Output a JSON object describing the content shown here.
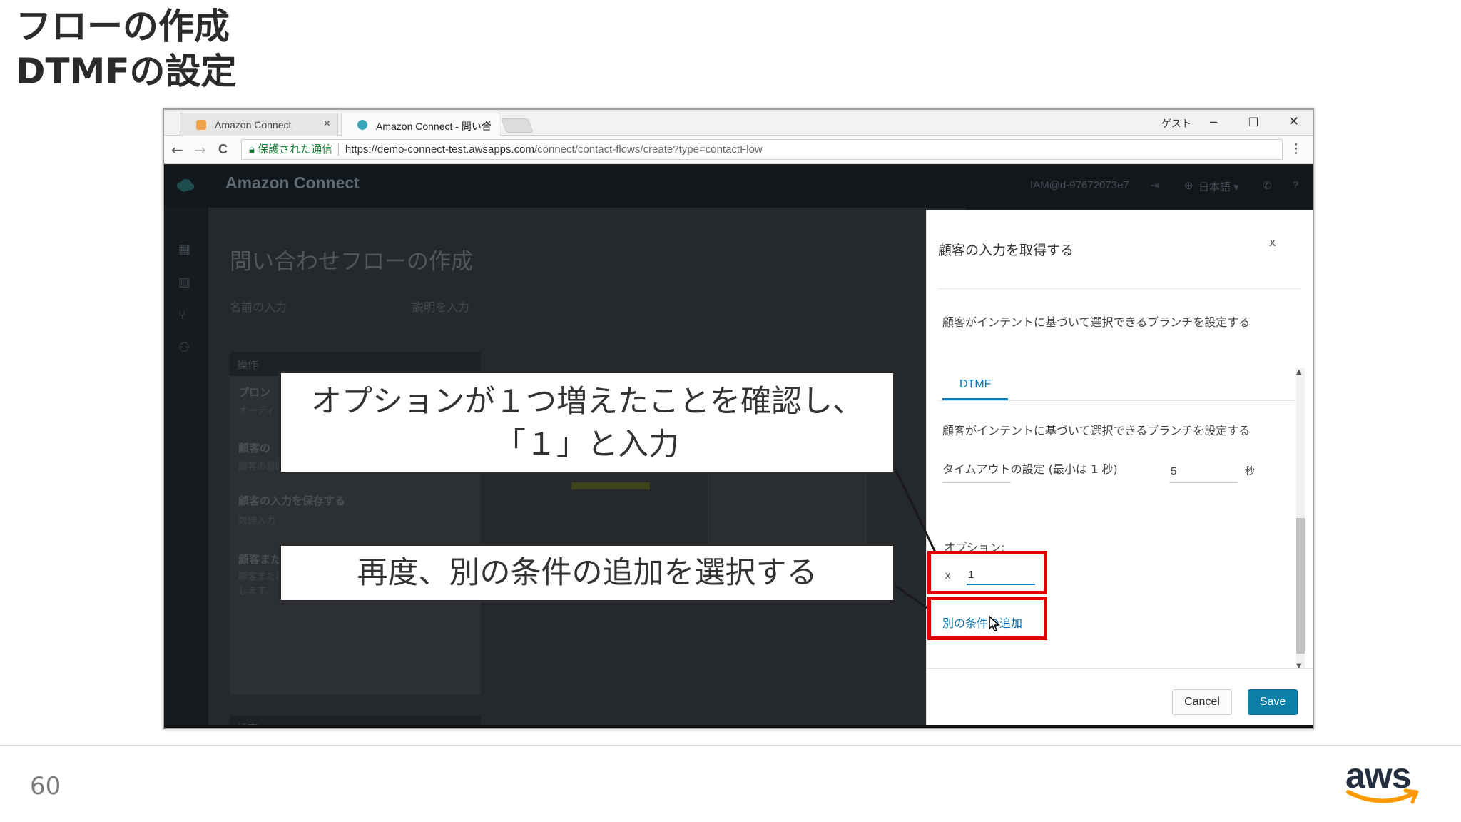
{
  "slide": {
    "title_line1": "フローの作成",
    "title_line2": "DTMFの設定",
    "page_number": "60",
    "logo_text": "aws"
  },
  "browser": {
    "tabs": [
      {
        "label": "Amazon Connect",
        "close": "×"
      },
      {
        "label": "Amazon Connect - 問い合",
        "close": "×"
      }
    ],
    "window_controls": {
      "guest": "ゲスト",
      "minimize": "–",
      "restore": "❐",
      "close": "✕"
    },
    "nav": {
      "back": "←",
      "forward": "→",
      "reload": "C"
    },
    "address": {
      "secure_label": "保護された通信",
      "url_host": "https://demo-connect-test.awsapps.com",
      "url_path": "/connect/contact-flows/create?type=contactFlow"
    },
    "menu": "⋮"
  },
  "app": {
    "title": "Amazon Connect",
    "user": "IAM@d-97672073e7",
    "language": "日本語 ▾",
    "help": "?",
    "page_heading": "問い合わせフローの作成",
    "name_placeholder": "名前の入力",
    "desc_placeholder": "説明を入力",
    "operations": {
      "header": "操作",
      "items": [
        {
          "title": "プロン",
          "desc": "オーディ"
        },
        {
          "title": "顧客の",
          "desc": "顧客の意図に基づいて分岐します。"
        },
        {
          "title": "顧客の入力を保存する",
          "desc": "数値入力"
        },
        {
          "title": "顧客またはエージェントの保留",
          "desc": "顧客またはエージェントとの通話を保留または保留解除します。"
        }
      ],
      "settings_header": "設定"
    }
  },
  "modal": {
    "title": "顧客の入力を取得する",
    "close": "x",
    "description": "顧客がインテントに基づいて選択できるブランチを設定する",
    "tab": "DTMF",
    "tab_description": "顧客がインテントに基づいて選択できるブランチを設定する",
    "timeout_label": "タイムアウトの設定 (最小は 1 秒)",
    "timeout_value": "5",
    "timeout_unit": "秒",
    "option_label": "オプション:",
    "option_remove": "x",
    "option_value": "1",
    "add_condition": "別の条件の追加",
    "cancel": "Cancel",
    "save": "Save"
  },
  "callouts": {
    "first_line1": "オプションが１つ増えたことを確認し、",
    "first_line2": "「１」と入力",
    "second": "再度、別の条件の追加を選択する"
  },
  "colors": {
    "highlight": "#e00000",
    "accent": "#0b7fa8"
  }
}
